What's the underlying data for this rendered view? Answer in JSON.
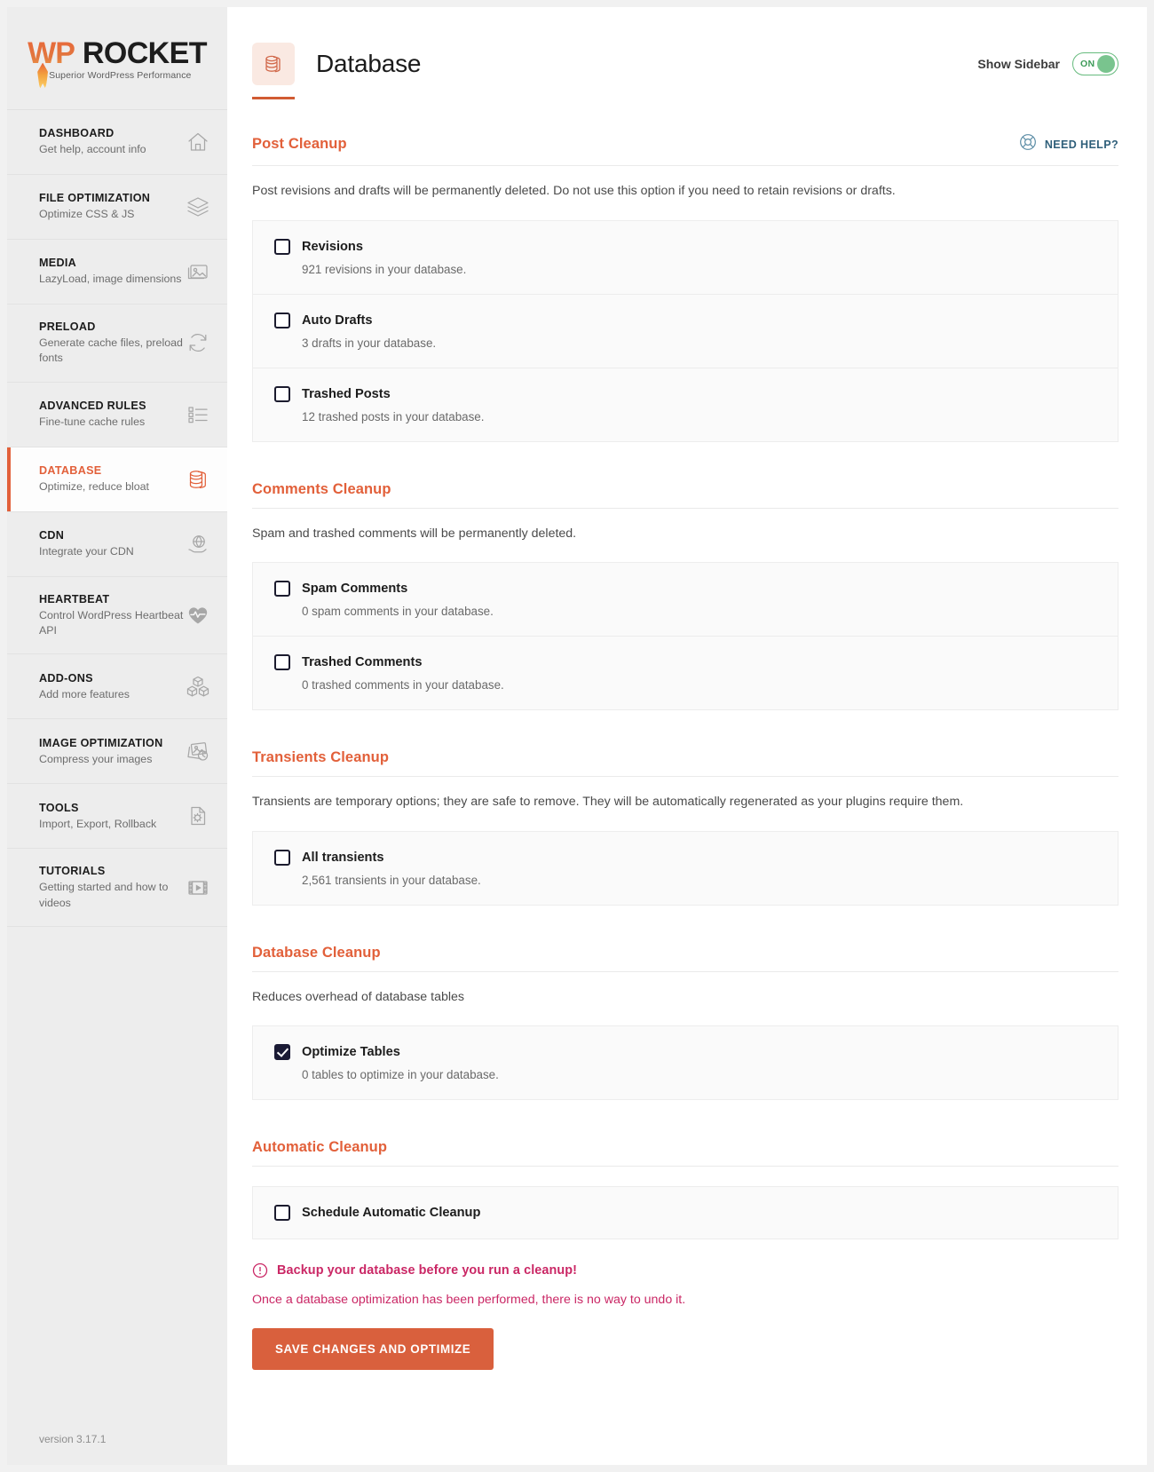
{
  "brand": {
    "name_wp": "WP",
    "name_rocket": "ROCKET",
    "tagline": "Superior WordPress Performance",
    "version": "version 3.17.1",
    "accent_color": "#e2603a",
    "button_color": "#d9603d",
    "warning_color": "#ca2765",
    "help_color": "#2f5f7a",
    "toggle_color": "#79c48e"
  },
  "sidebar": {
    "items": [
      {
        "title": "DASHBOARD",
        "desc": "Get help, account info",
        "icon": "home-icon",
        "active": false
      },
      {
        "title": "FILE OPTIMIZATION",
        "desc": "Optimize CSS & JS",
        "icon": "layers-icon",
        "active": false
      },
      {
        "title": "MEDIA",
        "desc": "LazyLoad, image dimensions",
        "icon": "image-icon",
        "active": false
      },
      {
        "title": "PRELOAD",
        "desc": "Generate cache files, preload fonts",
        "icon": "refresh-icon",
        "active": false
      },
      {
        "title": "ADVANCED RULES",
        "desc": "Fine-tune cache rules",
        "icon": "list-icon",
        "active": false
      },
      {
        "title": "DATABASE",
        "desc": "Optimize, reduce bloat",
        "icon": "database-icon",
        "active": true
      },
      {
        "title": "CDN",
        "desc": "Integrate your CDN",
        "icon": "cdn-icon",
        "active": false
      },
      {
        "title": "HEARTBEAT",
        "desc": "Control WordPress Heartbeat API",
        "icon": "heart-pulse-icon",
        "active": false
      },
      {
        "title": "ADD-ONS",
        "desc": "Add more features",
        "icon": "cubes-icon",
        "active": false
      },
      {
        "title": "IMAGE OPTIMIZATION",
        "desc": "Compress your images",
        "icon": "image-optimize-icon",
        "active": false
      },
      {
        "title": "TOOLS",
        "desc": "Import, Export, Rollback",
        "icon": "gear-file-icon",
        "active": false
      },
      {
        "title": "TUTORIALS",
        "desc": "Getting started and how to videos",
        "icon": "video-icon",
        "active": false
      }
    ]
  },
  "header": {
    "title": "Database",
    "icon": "database-icon",
    "show_sidebar_label": "Show Sidebar",
    "toggle_state": "ON"
  },
  "need_help": {
    "label": "NEED HELP?",
    "icon": "lifebuoy-icon"
  },
  "sections": [
    {
      "title": "Post Cleanup",
      "desc": "Post revisions and drafts will be permanently deleted. Do not use this option if you need to retain revisions or drafts.",
      "has_help": true,
      "options": [
        {
          "label": "Revisions",
          "sub": "921 revisions in your database.",
          "checked": false
        },
        {
          "label": "Auto Drafts",
          "sub": "3 drafts in your database.",
          "checked": false
        },
        {
          "label": "Trashed Posts",
          "sub": "12 trashed posts in your database.",
          "checked": false
        }
      ]
    },
    {
      "title": "Comments Cleanup",
      "desc": "Spam and trashed comments will be permanently deleted.",
      "has_help": false,
      "options": [
        {
          "label": "Spam Comments",
          "sub": "0 spam comments in your database.",
          "checked": false
        },
        {
          "label": "Trashed Comments",
          "sub": "0 trashed comments in your database.",
          "checked": false
        }
      ]
    },
    {
      "title": "Transients Cleanup",
      "desc": "Transients are temporary options; they are safe to remove. They will be automatically regenerated as your plugins require them.",
      "has_help": false,
      "options": [
        {
          "label": "All transients",
          "sub": "2,561 transients in your database.",
          "checked": false
        }
      ]
    },
    {
      "title": "Database Cleanup",
      "desc": "Reduces overhead of database tables",
      "has_help": false,
      "options": [
        {
          "label": "Optimize Tables",
          "sub": "0 tables to optimize in your database.",
          "checked": true
        }
      ]
    },
    {
      "title": "Automatic Cleanup",
      "desc": "",
      "has_help": false,
      "options": [
        {
          "label": "Schedule Automatic Cleanup",
          "sub": "",
          "checked": false
        }
      ]
    }
  ],
  "footer": {
    "warning_icon": "alert-circle-icon",
    "warning_strong": "Backup your database before you run a cleanup!",
    "warning_sub": "Once a database optimization has been performed, there is no way to undo it.",
    "save_button": "SAVE CHANGES AND OPTIMIZE"
  }
}
